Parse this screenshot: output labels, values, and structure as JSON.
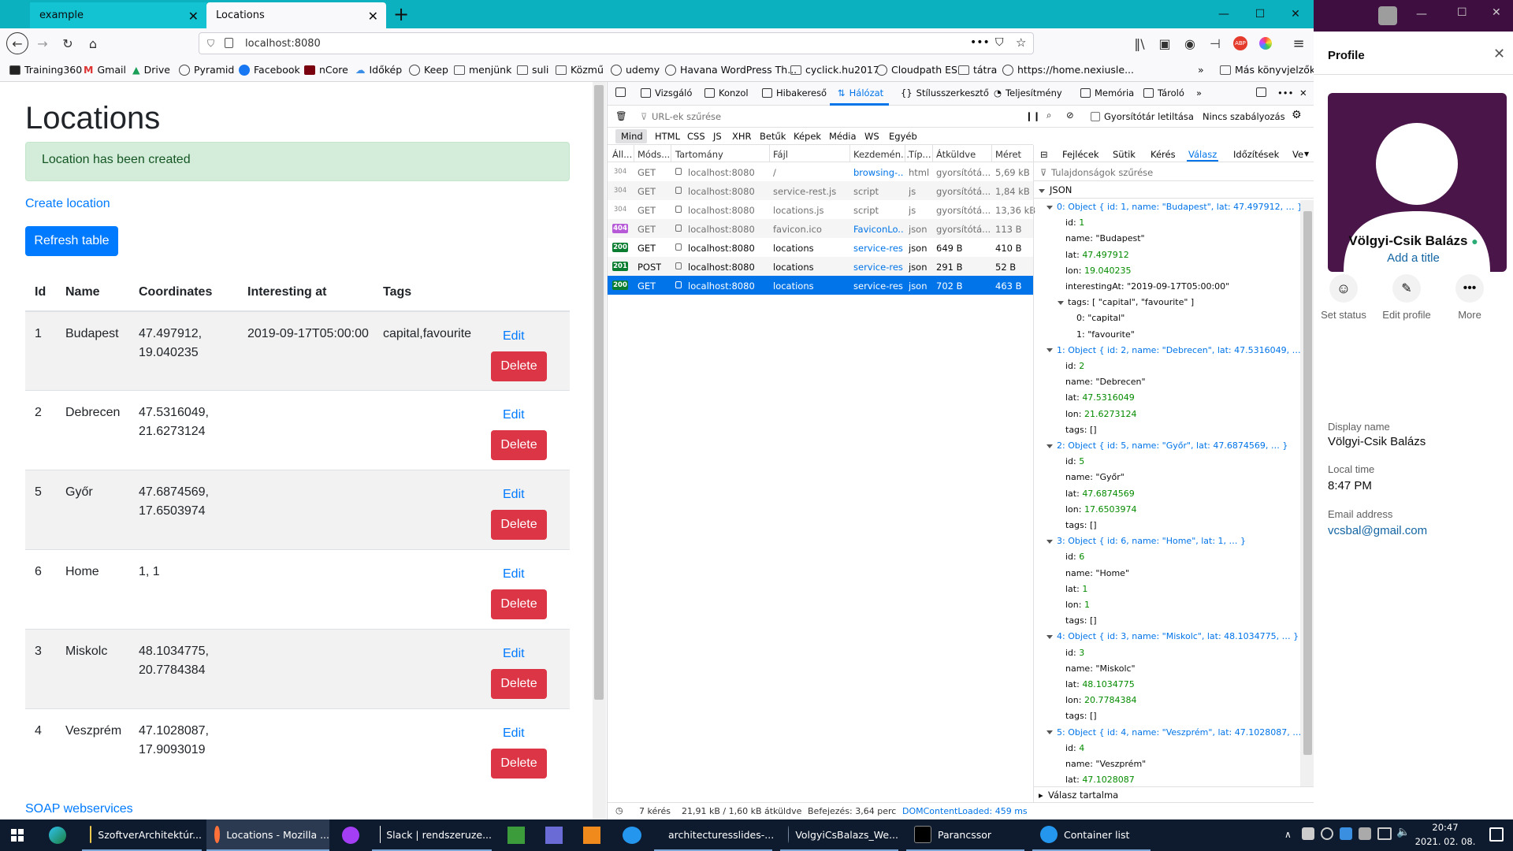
{
  "browser": {
    "tabs": [
      {
        "label": "example"
      },
      {
        "label": "Locations"
      }
    ],
    "url": "localhost:8080",
    "bookmarks": [
      "Training360",
      "Gmail",
      "Drive",
      "Pyramid",
      "Facebook",
      "nCore",
      "Időkép",
      "Keep",
      "menjünk",
      "suli",
      "Közmű",
      "udemy",
      "Havana WordPress Th...",
      "cyclick.hu2017",
      "Cloudpath ES",
      "tátra",
      "https://home.nexiusle...",
      "Más könyvjelzők"
    ]
  },
  "page": {
    "title": "Locations",
    "alert": "Location has been created",
    "create_link": "Create location",
    "refresh_button": "Refresh table",
    "table": {
      "headers": [
        "Id",
        "Name",
        "Coordinates",
        "Interesting at",
        "Tags"
      ],
      "rows": [
        {
          "id": "1",
          "name": "Budapest",
          "coord1": "47.497912,",
          "coord2": "19.040235",
          "interesting": "2019-09-17T05:00:00",
          "tags": "capital,favourite"
        },
        {
          "id": "2",
          "name": "Debrecen",
          "coord1": "47.5316049,",
          "coord2": "21.6273124",
          "interesting": "",
          "tags": ""
        },
        {
          "id": "5",
          "name": "Győr",
          "coord1": "47.6874569,",
          "coord2": "17.6503974",
          "interesting": "",
          "tags": ""
        },
        {
          "id": "6",
          "name": "Home",
          "coord1": "1, 1",
          "coord2": "",
          "interesting": "",
          "tags": ""
        },
        {
          "id": "3",
          "name": "Miskolc",
          "coord1": "48.1034775,",
          "coord2": "20.7784384",
          "interesting": "",
          "tags": ""
        },
        {
          "id": "4",
          "name": "Veszprém",
          "coord1": "47.1028087,",
          "coord2": "17.9093019",
          "interesting": "",
          "tags": ""
        }
      ],
      "edit_label": "Edit",
      "delete_label": "Delete"
    },
    "soap_link": "SOAP webservices"
  },
  "devtools": {
    "tabs": [
      "Vizsgáló",
      "Konzol",
      "Hibakereső",
      "Hálózat",
      "Stílusszerkesztő",
      "Teljesítmény",
      "Memória",
      "Tároló"
    ],
    "filter_placeholder": "URL-ek szűrése",
    "cache_label": "Gyorsítótár letiltása",
    "throttle": "Nincs szabályozás",
    "type_filters": [
      "Mind",
      "HTML",
      "CSS",
      "JS",
      "XHR",
      "Betűk",
      "Képek",
      "Média",
      "WS",
      "Egyéb"
    ],
    "columns": [
      "Áll...",
      "Móds...",
      "Tartomány",
      "Fájl",
      "Kezdemén...",
      "Típ...",
      "Átküldve",
      "Méret"
    ],
    "requests": [
      {
        "status": "304",
        "method": "GET",
        "domain": "localhost:8080",
        "file": "/",
        "initiator": "browsing-...",
        "type": "html",
        "transferred": "gyorsítótá...",
        "size": "5,69 kB"
      },
      {
        "status": "304",
        "method": "GET",
        "domain": "localhost:8080",
        "file": "service-rest.js",
        "initiator": "script",
        "type": "js",
        "transferred": "gyorsítótá...",
        "size": "1,84 kB"
      },
      {
        "status": "304",
        "method": "GET",
        "domain": "localhost:8080",
        "file": "locations.js",
        "initiator": "script",
        "type": "js",
        "transferred": "gyorsítótá...",
        "size": "13,36 kB"
      },
      {
        "status": "404",
        "method": "GET",
        "domain": "localhost:8080",
        "file": "favicon.ico",
        "initiator": "FaviconLo...",
        "type": "json",
        "transferred": "gyorsítótá...",
        "size": "113 B"
      },
      {
        "status": "200",
        "method": "GET",
        "domain": "localhost:8080",
        "file": "locations",
        "initiator": "service-res...",
        "type": "json",
        "transferred": "649 B",
        "size": "410 B"
      },
      {
        "status": "201",
        "method": "POST",
        "domain": "localhost:8080",
        "file": "locations",
        "initiator": "service-res...",
        "type": "json",
        "transferred": "291 B",
        "size": "52 B"
      },
      {
        "status": "200",
        "method": "GET",
        "domain": "localhost:8080",
        "file": "locations",
        "initiator": "service-res...",
        "type": "json",
        "transferred": "702 B",
        "size": "463 B"
      }
    ],
    "summary": {
      "requests": "7 kérés",
      "transferred": "21,91 kB / 1,60 kB átküldve",
      "finish": "Befejezés: 3,64 perc",
      "domcontent": "DOMContentLoaded: 459 ms"
    },
    "response_tabs": [
      "Fejlécek",
      "Sütik",
      "Kérés",
      "Válasz",
      "Időzítések",
      "Ve"
    ],
    "prop_filter": "Tulajdonságok szűrése",
    "json_label": "JSON",
    "response_content_label": "Válasz tartalma",
    "json_lines": [
      {
        "indent": 0,
        "tri": true,
        "text": "0: Object { id: 1, name: \"Budapest\", lat: 47.497912, … }",
        "cls": "ob"
      },
      {
        "indent": 1,
        "key": "id: ",
        "val": "1",
        "cls": "n"
      },
      {
        "indent": 1,
        "key": "name: ",
        "val": "\"Budapest\"",
        "cls": "s"
      },
      {
        "indent": 1,
        "key": "lat: ",
        "val": "47.497912",
        "cls": "n"
      },
      {
        "indent": 1,
        "key": "lon: ",
        "val": "19.040235",
        "cls": "n"
      },
      {
        "indent": 1,
        "key": "interestingAt: ",
        "val": "\"2019-09-17T05:00:00\"",
        "cls": "s"
      },
      {
        "indent": 1,
        "tri": true,
        "key": "tags: ",
        "val": "[ \"capital\", \"favourite\" ]",
        "cls": "s"
      },
      {
        "indent": 2,
        "key": "0: ",
        "val": "\"capital\"",
        "cls": "s"
      },
      {
        "indent": 2,
        "key": "1: ",
        "val": "\"favourite\"",
        "cls": "s"
      },
      {
        "indent": 0,
        "tri": true,
        "text": "1: Object { id: 2, name: \"Debrecen\", lat: 47.5316049, … }",
        "cls": "ob"
      },
      {
        "indent": 1,
        "key": "id: ",
        "val": "2",
        "cls": "n"
      },
      {
        "indent": 1,
        "key": "name: ",
        "val": "\"Debrecen\"",
        "cls": "s"
      },
      {
        "indent": 1,
        "key": "lat: ",
        "val": "47.5316049",
        "cls": "n"
      },
      {
        "indent": 1,
        "key": "lon: ",
        "val": "21.6273124",
        "cls": "n"
      },
      {
        "indent": 1,
        "key": "tags: ",
        "val": "[]",
        "cls": "s"
      },
      {
        "indent": 0,
        "tri": true,
        "text": "2: Object { id: 5, name: \"Győr\", lat: 47.6874569, … }",
        "cls": "ob"
      },
      {
        "indent": 1,
        "key": "id: ",
        "val": "5",
        "cls": "n"
      },
      {
        "indent": 1,
        "key": "name: ",
        "val": "\"Győr\"",
        "cls": "s"
      },
      {
        "indent": 1,
        "key": "lat: ",
        "val": "47.6874569",
        "cls": "n"
      },
      {
        "indent": 1,
        "key": "lon: ",
        "val": "17.6503974",
        "cls": "n"
      },
      {
        "indent": 1,
        "key": "tags: ",
        "val": "[]",
        "cls": "s"
      },
      {
        "indent": 0,
        "tri": true,
        "text": "3: Object { id: 6, name: \"Home\", lat: 1, … }",
        "cls": "ob"
      },
      {
        "indent": 1,
        "key": "id: ",
        "val": "6",
        "cls": "n"
      },
      {
        "indent": 1,
        "key": "name: ",
        "val": "\"Home\"",
        "cls": "s"
      },
      {
        "indent": 1,
        "key": "lat: ",
        "val": "1",
        "cls": "n"
      },
      {
        "indent": 1,
        "key": "lon: ",
        "val": "1",
        "cls": "n"
      },
      {
        "indent": 1,
        "key": "tags: ",
        "val": "[]",
        "cls": "s"
      },
      {
        "indent": 0,
        "tri": true,
        "text": "4: Object { id: 3, name: \"Miskolc\", lat: 48.1034775, … }",
        "cls": "ob"
      },
      {
        "indent": 1,
        "key": "id: ",
        "val": "3",
        "cls": "n"
      },
      {
        "indent": 1,
        "key": "name: ",
        "val": "\"Miskolc\"",
        "cls": "s"
      },
      {
        "indent": 1,
        "key": "lat: ",
        "val": "48.1034775",
        "cls": "n"
      },
      {
        "indent": 1,
        "key": "lon: ",
        "val": "20.7784384",
        "cls": "n"
      },
      {
        "indent": 1,
        "key": "tags: ",
        "val": "[]",
        "cls": "s"
      },
      {
        "indent": 0,
        "tri": true,
        "text": "5: Object { id: 4, name: \"Veszprém\", lat: 47.1028087, … }",
        "cls": "ob"
      },
      {
        "indent": 1,
        "key": "id: ",
        "val": "4",
        "cls": "n"
      },
      {
        "indent": 1,
        "key": "name: ",
        "val": "\"Veszprém\"",
        "cls": "s"
      },
      {
        "indent": 1,
        "key": "lat: ",
        "val": "47.1028087",
        "cls": "n"
      }
    ]
  },
  "slack": {
    "panel_title": "Profile",
    "user_name": "Völgyi-Csik Balázs",
    "add_title": "Add a title",
    "actions": [
      "Set status",
      "Edit profile",
      "More"
    ],
    "display_name_label": "Display name",
    "display_name": "Völgyi-Csik Balázs",
    "local_time_label": "Local time",
    "local_time": "8:47 PM",
    "email_label": "Email address",
    "email": "vcsbal@gmail.com"
  },
  "taskbar": {
    "items": [
      "SzoftverArchitektúr...",
      "Locations - Mozilla ...",
      "Slack | rendszeruze...",
      "architecturesslides-...",
      "VolgyiCsBalazs_We...",
      "Parancssor",
      "Container list"
    ],
    "time": "20:47",
    "date": "2021. 02. 08."
  }
}
